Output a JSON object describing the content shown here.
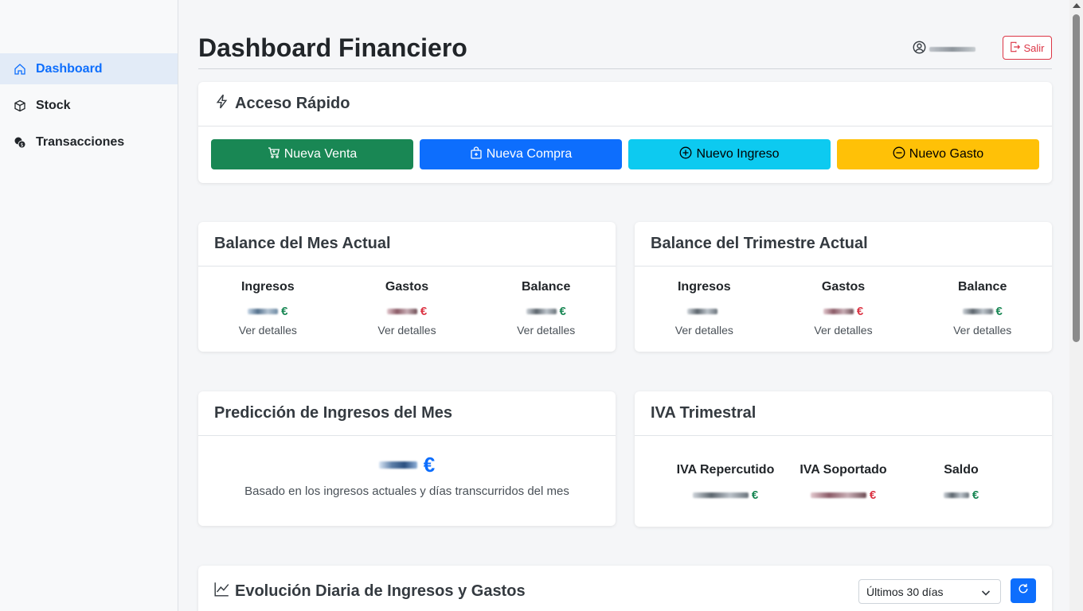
{
  "sidebar": {
    "items": [
      {
        "label": "Dashboard",
        "icon": "home-icon",
        "active": true
      },
      {
        "label": "Stock",
        "icon": "box-icon"
      },
      {
        "label": "Transacciones",
        "icon": "coins-icon"
      }
    ]
  },
  "header": {
    "title": "Dashboard Financiero",
    "logout_label": "Salir"
  },
  "quick_access": {
    "title": "Acceso Rápido",
    "buttons": [
      {
        "label": "Nueva Venta",
        "icon": "cart-icon",
        "color": "#198754"
      },
      {
        "label": "Nueva Compra",
        "icon": "bag-plus-icon",
        "color": "#0d6efd"
      },
      {
        "label": "Nuevo Ingreso",
        "icon": "plus-circle-icon",
        "color": "#0dcaf0"
      },
      {
        "label": "Nuevo Gasto",
        "icon": "dash-circle-icon",
        "color": "#ffc107"
      }
    ]
  },
  "balance_month": {
    "title": "Balance del Mes Actual",
    "stats": [
      {
        "label": "Ingresos",
        "currency": "€",
        "link": "Ver detalles"
      },
      {
        "label": "Gastos",
        "currency": "€",
        "link": "Ver detalles"
      },
      {
        "label": "Balance",
        "currency": "€",
        "link": "Ver detalles"
      }
    ]
  },
  "balance_quarter": {
    "title": "Balance del Trimestre Actual",
    "stats": [
      {
        "label": "Ingresos",
        "currency": "",
        "link": "Ver detalles"
      },
      {
        "label": "Gastos",
        "currency": "€",
        "link": "Ver detalles"
      },
      {
        "label": "Balance",
        "currency": "€",
        "link": "Ver detalles"
      }
    ]
  },
  "prediction": {
    "title": "Predicción de Ingresos del Mes",
    "currency": "€",
    "note": "Basado en los ingresos actuales y días transcurridos del mes"
  },
  "iva": {
    "title": "IVA Trimestral",
    "stats": [
      {
        "label": "IVA Repercutido",
        "currency": "€"
      },
      {
        "label": "IVA Soportado",
        "currency": "€"
      },
      {
        "label": "Saldo",
        "currency": "€"
      }
    ]
  },
  "evolution": {
    "title": "Evolución Diaria de Ingresos y Gastos",
    "range_selected": "Últimos 30 días"
  },
  "colors": {
    "primary": "#0d6efd",
    "success": "#198754",
    "danger": "#dc3545",
    "info": "#0dcaf0",
    "warning": "#ffc107"
  }
}
